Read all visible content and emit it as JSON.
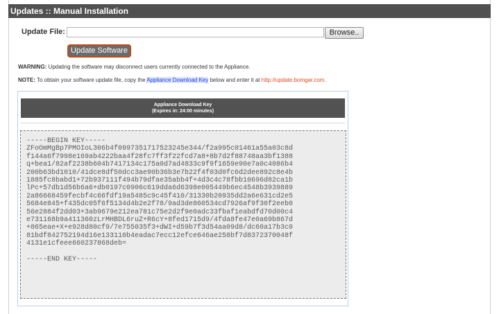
{
  "title": "Updates :: Manual Installation",
  "form": {
    "update_file_label": "Update File:",
    "file_value": "",
    "browse_label": "Browse..",
    "update_button_label": "Update Software"
  },
  "warning": {
    "prefix": "WARNING:",
    "text": " Updating the software may disconnect users currently connected to the Appliance."
  },
  "note": {
    "prefix": "NOTE:",
    "text_before": " To obtain your software update file, copy the ",
    "highlight": "Appliance Download Key",
    "text_middle": " below and enter it at ",
    "link": "http://update.bomgar.com",
    "text_after": "."
  },
  "key_panel": {
    "header_title": "Appliance Download Key",
    "header_expiry": "(Expires in: 24:00 minutes)",
    "key_lines": [
      "-----BEGIN KEY-----",
      "ZFoOmMgBp7PMOIoL306b4f0997351717523245e344/f2a995c01461a55a03c8d",
      "f144a6f7998e169ab4222baa4f28fc7ff3f22fcd7a8+8b7d2f88748aa3bf1388",
      "q+bea1/82af2238b604b7417134c175a0d7ad4833c9f9f1659e90e7a0c4086b4",
      "200b63bd1010/41dce8df50dcc3ae90b36b3e7b22f4f03d0fc6d2dee892c8e4b",
      "1885fc8babd1+72b937111f494b79dfae35abb4f+4d3c4c78fbb10696d82ca1b",
      "lPc+57db1d56b6a6+db0197c0906c619dda6d6398e005449b6ec4548b3939889",
      "2a86668459fecbf4c66fdf19a5485c9c45f410/31330b20935dd2a6e631cd2e5",
      "5684e845+f435dc05f6f5134d4b2e2f78/9ad3de860534cd7926af9f30f2eeb0",
      "56e2884f2dd03+3ab9679e212ea781c75e2d2f9e0adc33fbaf1eabdfd70d00c4",
      "e731168b9a411360zLrMHBDL6ruZ+R6cY+8fed1715d9/4fda8fe47e0a69b867d",
      "+865eae+X+e928d80cf9/7e755035f3+dWI+d59b7f3d54aa09d8/dc60a17b3c0",
      "81bdf842752194d16e133110b4eadac7ecc12efce646ae258bf7d8372370048f",
      "4131e1cfeee660237868deb=",
      "",
      "-----END KEY-----"
    ]
  },
  "colors": {
    "title_bar": "#505050",
    "accent_border": "#c24a18",
    "link": "#e0441e",
    "highlight": "#1f3fd6"
  }
}
